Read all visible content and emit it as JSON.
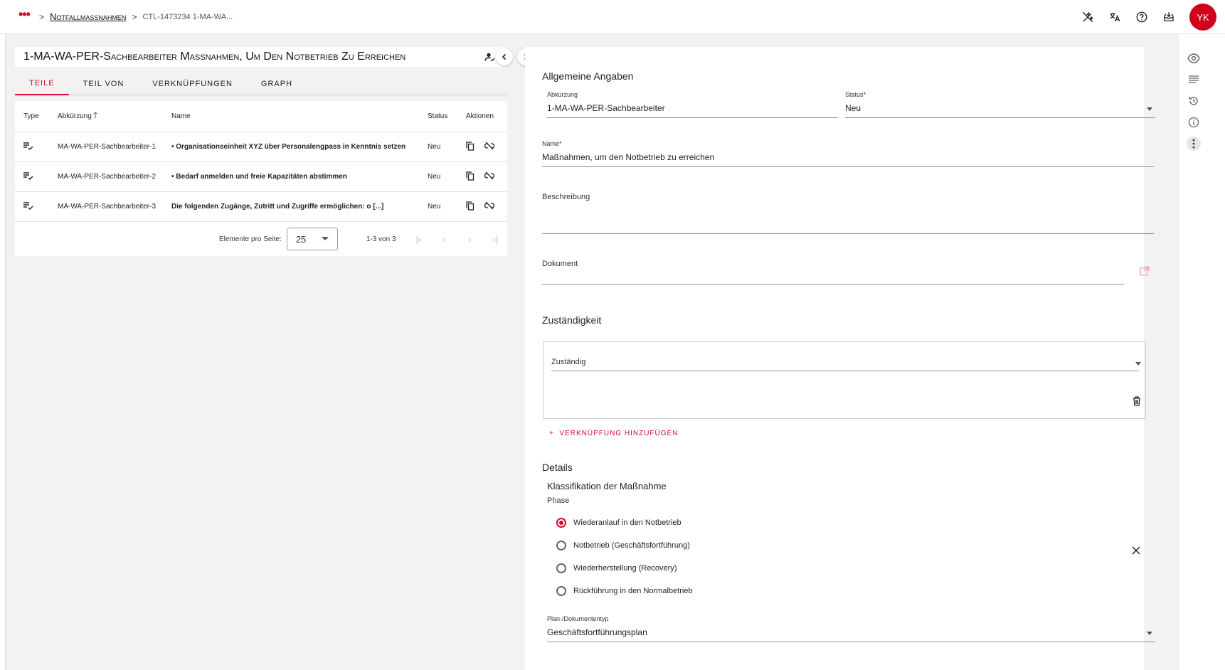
{
  "header": {
    "menu_dots": "•••",
    "breadcrumb_sep": ">",
    "breadcrumb_link": "Notfallmaßnahmen",
    "breadcrumb_current": "CTL-1473234 1-MA-WA...",
    "avatar_initials": "YK",
    "icons": [
      "magic-off-icon",
      "translate-icon",
      "help-icon",
      "inbox-icon"
    ]
  },
  "left": {
    "title": "1-MA-WA-PER-Sachbearbeiter Maßnahmen, Um Den Notbetrieb Zu Erreichen",
    "tabs": [
      "Teile",
      "Teil von",
      "Verknüpfungen",
      "Graph"
    ],
    "table": {
      "headers": {
        "type": "Type",
        "abk": "Abkürzung",
        "name": "Name",
        "status": "Status",
        "actions": "Aktionen"
      },
      "rows": [
        {
          "abk": "MA-WA-PER-Sachbearbeiter-1",
          "name": "• Organisationseinheit XYZ über Personalengpass in Kenntnis setzen",
          "status": "Neu"
        },
        {
          "abk": "MA-WA-PER-Sachbearbeiter-2",
          "name": "• Bedarf anmelden und freie Kapazitäten abstimmen",
          "status": "Neu"
        },
        {
          "abk": "MA-WA-PER-Sachbearbeiter-3",
          "name": "Die folgenden Zugänge, Zutritt und Zugriffe ermöglichen: o [...]",
          "status": "Neu"
        }
      ]
    },
    "paginator": {
      "label": "Elemente pro Seite:",
      "page_size": "25",
      "range": "1-3 von 3"
    }
  },
  "right": {
    "general_title": "Allgemeine Angaben",
    "abk_label": "Abkürzung",
    "abk_value": "1-MA-WA-PER-Sachbearbeiter",
    "status_label": "Status*",
    "status_value": "Neu",
    "name_label": "Name*",
    "name_value": "Maßnahmen, um den Notbetrieb zu erreichen",
    "beschreibung_label": "Beschreibung",
    "dokument_label": "Dokument",
    "zust_title": "Zuständigkeit",
    "zust_label": "Zuständig",
    "add_link": "Verknüpfung hinzufügen",
    "details_title": "Details",
    "klass_title": "Klassifikation der Maßnahme",
    "phase_label": "Phase",
    "phases": [
      {
        "label": "Wiederanlauf in den Notbetrieb",
        "selected": true
      },
      {
        "label": "Notbetrieb (Geschäftsfortführung)",
        "selected": false
      },
      {
        "label": "Wiederherstellung (Recovery)",
        "selected": false
      },
      {
        "label": "Rückführung in den Normalbetrieb",
        "selected": false
      }
    ],
    "plan_label": "Plan-/Dokumententyp",
    "plan_value": "Geschäftsfortführungsplan"
  },
  "rail_icons": [
    "eye-icon",
    "list-icon",
    "history-icon",
    "info-icon",
    "more-vertical-icon"
  ],
  "colors": {
    "accent": "#c8102e",
    "avatar": "#d0021b"
  }
}
